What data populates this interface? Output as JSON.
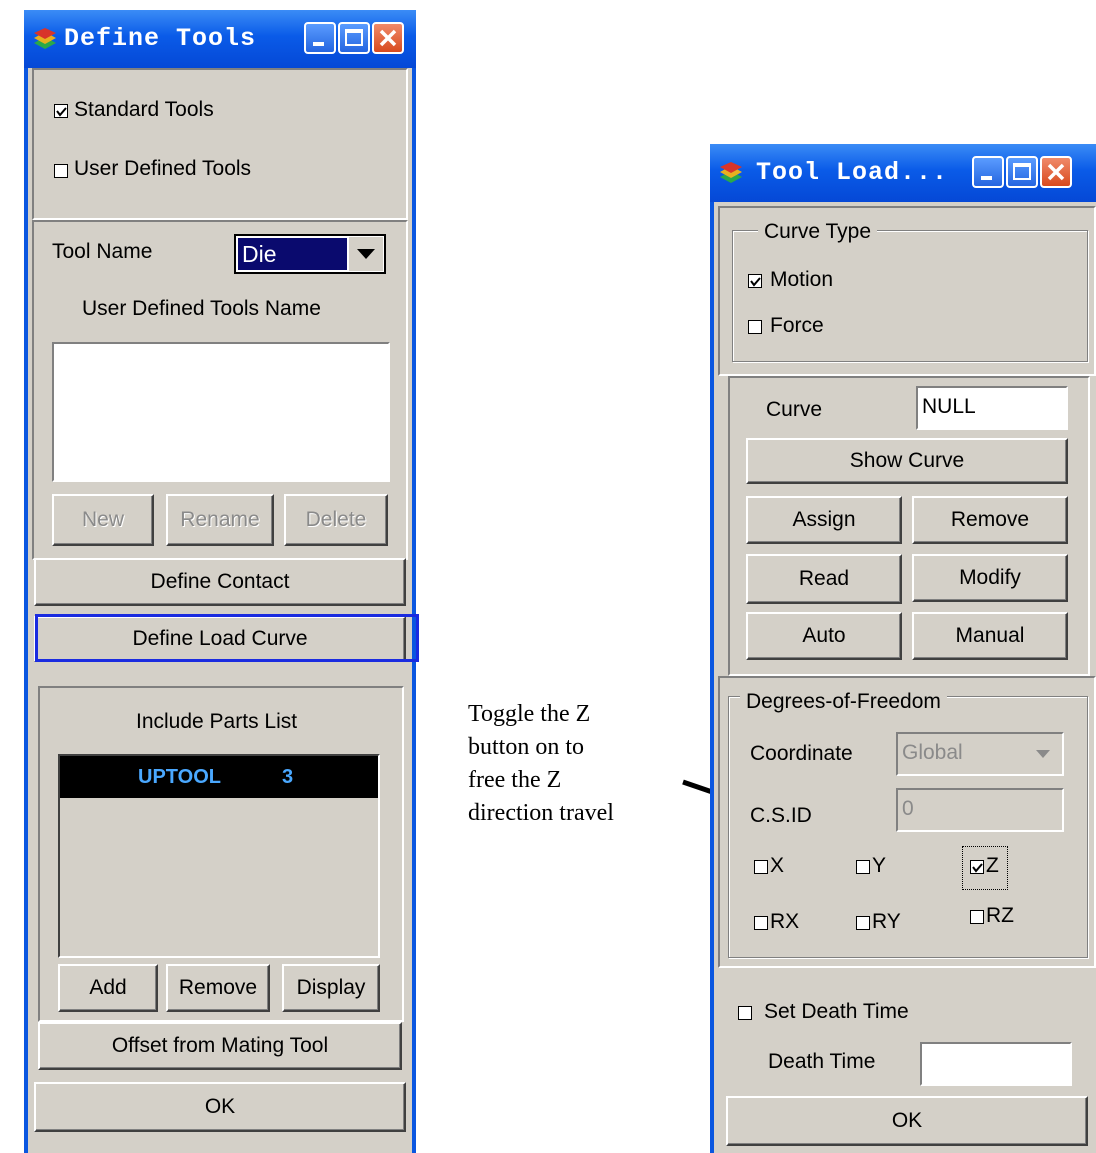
{
  "define_tools": {
    "title": "Define Tools",
    "standard_tools_label": "Standard Tools",
    "standard_tools_checked": true,
    "user_defined_tools_label": "User Defined Tools",
    "user_defined_tools_checked": false,
    "tool_name_label": "Tool Name",
    "tool_name_value": "Die",
    "user_defined_tools_name_label": "User Defined Tools Name",
    "new_label": "New",
    "rename_label": "Rename",
    "delete_label": "Delete",
    "define_contact_label": "Define Contact",
    "define_load_curve_label": "Define Load Curve",
    "include_parts_list_label": "Include Parts List",
    "parts": [
      {
        "name": "UPTOOL",
        "id": "3"
      }
    ],
    "add_label": "Add",
    "remove_label": "Remove",
    "display_label": "Display",
    "offset_label": "Offset from Mating Tool",
    "ok_label": "OK"
  },
  "tool_load": {
    "title": "Tool Load...",
    "curve_type_label": "Curve Type",
    "motion_label": "Motion",
    "motion_checked": true,
    "force_label": "Force",
    "force_checked": false,
    "curve_label": "Curve",
    "curve_value": "NULL",
    "show_curve_label": "Show Curve",
    "assign_label": "Assign",
    "remove_label": "Remove",
    "read_label": "Read",
    "modify_label": "Modify",
    "auto_label": "Auto",
    "manual_label": "Manual",
    "dof_label": "Degrees-of-Freedom",
    "coordinate_label": "Coordinate",
    "coordinate_value": "Global",
    "csid_label": "C.S.ID",
    "csid_value": "0",
    "x_label": "X",
    "y_label": "Y",
    "z_label": "Z",
    "rx_label": "RX",
    "ry_label": "RY",
    "rz_label": "RZ",
    "z_checked": true,
    "set_death_time_label": "Set Death Time",
    "death_time_label": "Death Time",
    "death_time_value": "",
    "ok_label": "OK"
  },
  "annotation": {
    "line1": "Toggle the Z",
    "line2": "button on to",
    "line3": "free the Z",
    "line4": "direction travel"
  },
  "colors": {
    "titlebar": "#0a5be8",
    "highlight": "#1a2be0",
    "selection": "#0a0a6e"
  }
}
